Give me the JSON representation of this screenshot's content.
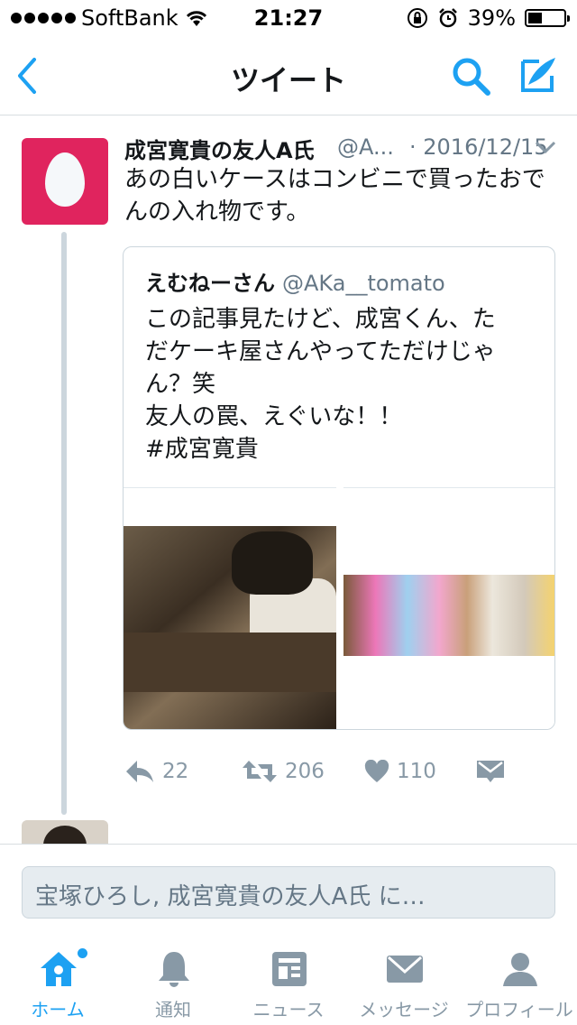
{
  "status_bar": {
    "carrier": "SoftBank",
    "time": "21:27",
    "battery": "39%"
  },
  "nav": {
    "title": "ツイート"
  },
  "tweet": {
    "name": "成宮寛貴の友人A氏",
    "handle": "@A...",
    "date": "· 2016/12/15",
    "text": "あの白いケースはコンビニで買ったおでんの入れ物です。",
    "quote": {
      "name": "えむねーさん",
      "handle": "@AKa__tomato",
      "lines": [
        "この記事見たけど、成宮くん、た",
        "だケーキ屋さんやってただけじゃ",
        "ん？笑",
        "友人の罠、えぐいな！！",
        "#成宮寛貴"
      ]
    },
    "actions": {
      "replies": "22",
      "retweets": "206",
      "likes": "110"
    }
  },
  "reply_bar": {
    "placeholder": "宝塚ひろし, 成宮寛貴の友人A氏 に…"
  },
  "tabbar": {
    "home": "ホーム",
    "notifications": "通知",
    "news": "ニュース",
    "messages": "メッセージ",
    "profile": "プロフィール"
  },
  "colors": {
    "accent": "#1da1f2",
    "egg_bg": "#e0245e",
    "muted": "#8899a6"
  }
}
